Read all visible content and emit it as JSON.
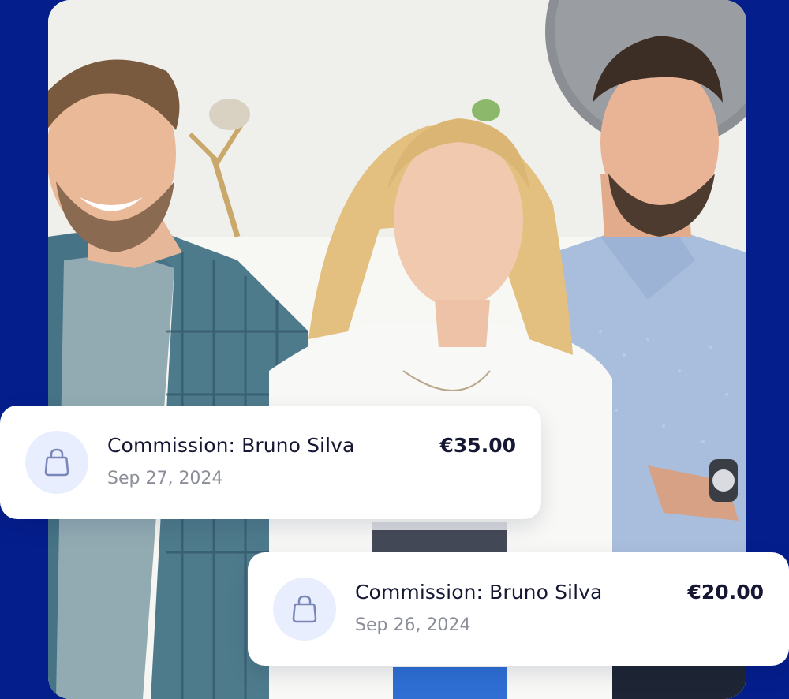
{
  "colors": {
    "brand_blue": "#041e8c",
    "card_bg": "#ffffff",
    "title_text": "#151733",
    "date_text": "#8b8e98",
    "icon_circle": "#e8eefd",
    "icon_stroke": "#7a86b8"
  },
  "transactions": [
    {
      "title": "Commission: Bruno Silva",
      "date": "Sep 27, 2024",
      "amount": "€35.00",
      "icon": "shopping-bag-icon"
    },
    {
      "title": "Commission: Bruno Silva",
      "date": "Sep 26, 2024",
      "amount": "€20.00",
      "icon": "shopping-bag-icon"
    }
  ]
}
